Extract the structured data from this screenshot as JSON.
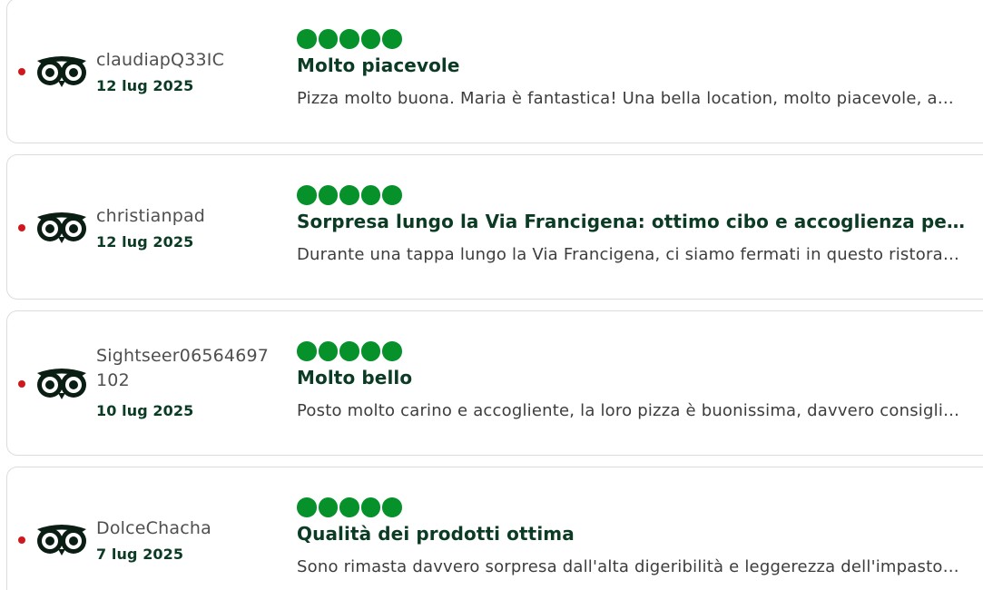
{
  "colors": {
    "bubble_filled": "#06912b",
    "title_text": "#0b3b24",
    "indicator_dot": "#d0171d"
  },
  "reviews": [
    {
      "source_icon": "tripadvisor-owl-icon",
      "username": "claudiapQ33IC",
      "date": "12 lug 2025",
      "rating": 5,
      "title": "Molto piacevole",
      "excerpt": "Pizza molto buona. Maria è fantastica! Una bella location, molto piacevole, accogliente e curata."
    },
    {
      "source_icon": "tripadvisor-owl-icon",
      "username": "christianpad",
      "date": "12 lug 2025",
      "rating": 5,
      "title": "Sorpresa lungo la Via Francigena: ottimo cibo e accoglienza perfetta",
      "excerpt": "Durante una tappa lungo la Via Francigena, ci siamo fermati in questo ristorante e siamo rimasti piacevolmente sorpresi."
    },
    {
      "source_icon": "tripadvisor-owl-icon",
      "username": "Sightseer06564697102",
      "date": "10 lug 2025",
      "rating": 5,
      "title": "Molto bello",
      "excerpt": "Posto molto carino e accogliente, la loro pizza è buonissima, davvero consigliato a tutti."
    },
    {
      "source_icon": "tripadvisor-owl-icon",
      "username": "DolceChacha",
      "date": "7 lug 2025",
      "rating": 5,
      "title": "Qualità dei prodotti ottima",
      "excerpt": "Sono rimasta davvero sorpresa dall'alta digeribilità e leggerezza dell'impasto della pizza."
    }
  ]
}
